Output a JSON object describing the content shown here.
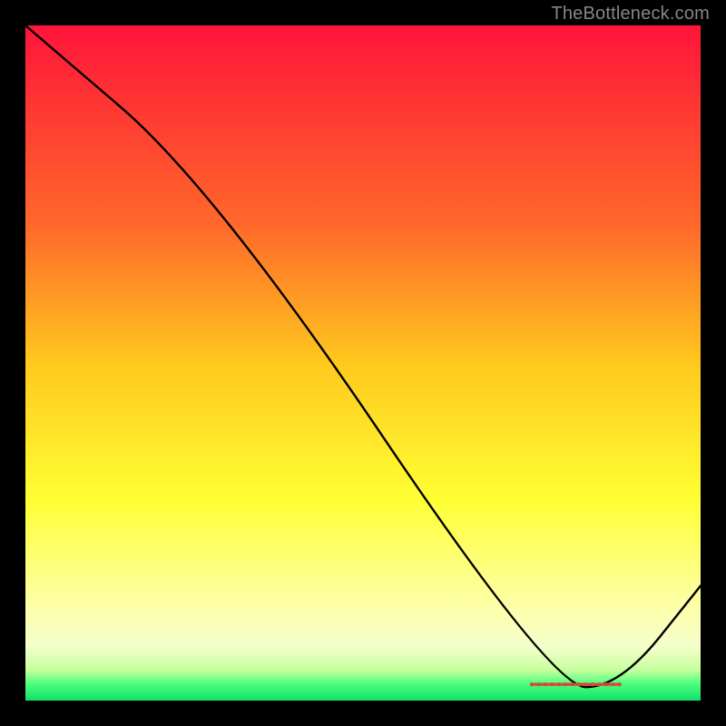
{
  "watermark": "TheBottleneck.com",
  "chart_data": {
    "type": "line",
    "title": "",
    "xlabel": "",
    "ylabel": "",
    "xlim": [
      0,
      100
    ],
    "ylim": [
      0,
      100
    ],
    "gradient_stops": [
      {
        "pos": 0.0,
        "color": "#ff143a"
      },
      {
        "pos": 0.3,
        "color": "#ff6a2a"
      },
      {
        "pos": 0.5,
        "color": "#ffc81e"
      },
      {
        "pos": 0.7,
        "color": "#ffff33"
      },
      {
        "pos": 0.86,
        "color": "#fdffa8"
      },
      {
        "pos": 0.92,
        "color": "#f4ffcc"
      },
      {
        "pos": 0.955,
        "color": "#c6ff9e"
      },
      {
        "pos": 0.975,
        "color": "#4cff7c"
      },
      {
        "pos": 1.0,
        "color": "#11e06a"
      }
    ],
    "series": [
      {
        "name": "curve",
        "x": [
          0,
          28,
          78,
          88,
          100
        ],
        "y": [
          100,
          76,
          2,
          2,
          17
        ]
      }
    ],
    "markers": {
      "name": "highlight",
      "x": [
        75,
        76,
        77,
        78,
        79,
        80,
        81,
        82,
        83,
        84,
        85,
        86,
        87,
        88
      ],
      "y": [
        2.4,
        2.4,
        2.4,
        2.4,
        2.4,
        2.4,
        2.4,
        2.4,
        2.4,
        2.4,
        2.4,
        2.4,
        2.4,
        2.4
      ],
      "color": "#d34a3c",
      "radius": 2.1
    }
  }
}
